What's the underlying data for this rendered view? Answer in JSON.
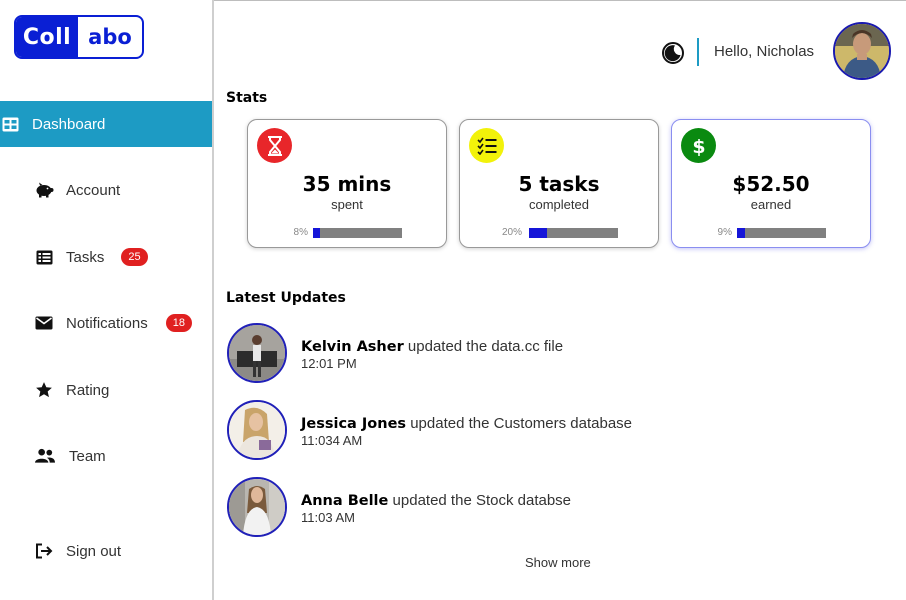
{
  "logo": {
    "part1": "Coll",
    "part2": "abo"
  },
  "sidebar": {
    "items": [
      {
        "label": "Dashboard",
        "icon": "table-icon",
        "active": true
      },
      {
        "label": "Account",
        "icon": "piggy-bank-icon"
      },
      {
        "label": "Tasks",
        "icon": "list-table-icon",
        "badge": "25"
      },
      {
        "label": "Notifications",
        "icon": "envelope-icon",
        "badge": "18"
      },
      {
        "label": "Rating",
        "icon": "star-icon"
      },
      {
        "label": "Team",
        "icon": "users-icon"
      }
    ],
    "signout": {
      "label": "Sign out",
      "icon": "sign-out-icon"
    }
  },
  "header": {
    "greeting": "Hello, Nicholas",
    "theme_icon": "moon-icon"
  },
  "stats": {
    "title": "Stats",
    "cards": [
      {
        "value": "35 mins",
        "sub": "spent",
        "percent_label": "8%",
        "progress": 0.08,
        "icon": "hourglass-icon",
        "icon_color": "#e8262a"
      },
      {
        "value": "5 tasks",
        "sub": "completed",
        "percent_label": "20%",
        "progress": 0.2,
        "icon": "checklist-icon",
        "icon_color": "#f2f20a"
      },
      {
        "value": "$52.50",
        "sub": "earned",
        "percent_label": "9%",
        "progress": 0.09,
        "icon": "dollar-icon",
        "icon_color": "#0a8a10"
      }
    ]
  },
  "updates": {
    "title": "Latest Updates",
    "items": [
      {
        "name": "Kelvin Asher",
        "action": " updated the data.cc file",
        "time": "12:01 PM"
      },
      {
        "name": "Jessica Jones",
        "action": " updated the Customers database",
        "time": "11:034 AM"
      },
      {
        "name": "Anna Belle",
        "action": " updated the Stock databse",
        "time": "11:03 AM"
      }
    ],
    "show_more": "Show more"
  },
  "colors": {
    "accent": "#1d9bc4",
    "brand": "#0a1fd4",
    "badge": "#e02020",
    "bar_fill": "#1515d8",
    "bar_track": "#808080"
  }
}
